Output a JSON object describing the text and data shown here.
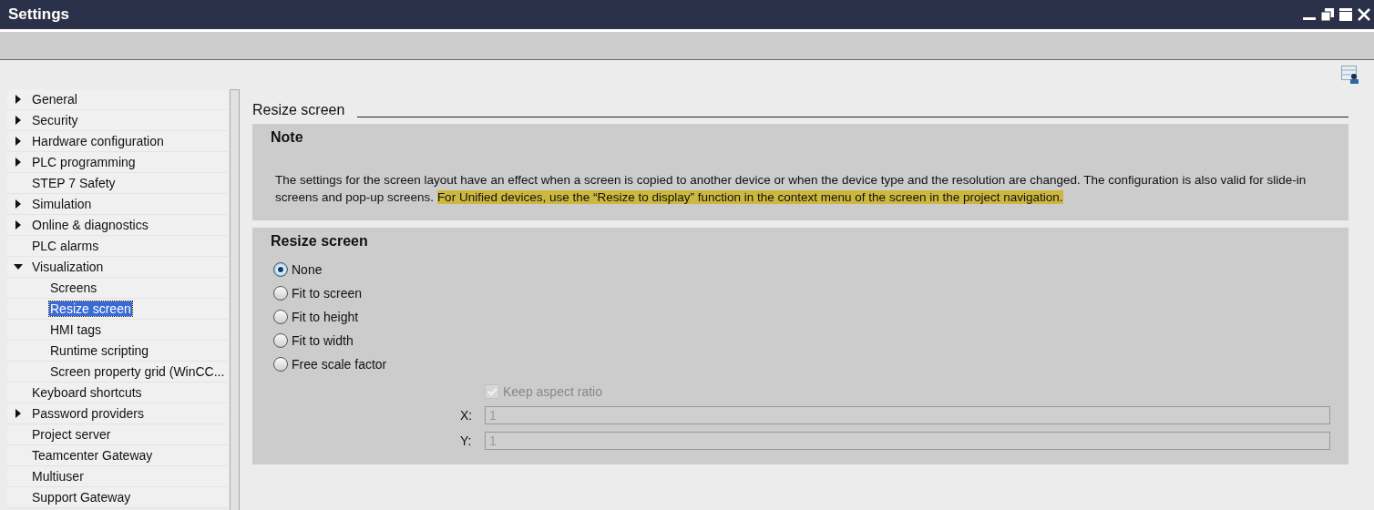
{
  "window": {
    "title": "Settings"
  },
  "sidebar": {
    "items": [
      {
        "label": "General",
        "expanded": false,
        "selected": false
      },
      {
        "label": "Security",
        "expanded": false,
        "selected": false
      },
      {
        "label": "Hardware configuration",
        "expanded": false,
        "selected": false
      },
      {
        "label": "PLC programming",
        "expanded": false,
        "selected": false
      },
      {
        "label": "STEP 7 Safety",
        "selected": false
      },
      {
        "label": "Simulation",
        "expanded": false,
        "selected": false
      },
      {
        "label": "Online & diagnostics",
        "expanded": false,
        "selected": false
      },
      {
        "label": "PLC alarms",
        "selected": false
      },
      {
        "label": "Visualization",
        "expanded": true,
        "selected": false,
        "children": [
          {
            "label": "Screens",
            "selected": false
          },
          {
            "label": "Resize screen",
            "selected": true
          },
          {
            "label": "HMI tags",
            "selected": false
          },
          {
            "label": "Runtime scripting",
            "selected": false
          },
          {
            "label": "Screen property grid (WinCC...",
            "selected": false
          }
        ]
      },
      {
        "label": "Keyboard shortcuts",
        "selected": false
      },
      {
        "label": "Password providers",
        "expanded": false,
        "selected": false
      },
      {
        "label": "Project server",
        "selected": false
      },
      {
        "label": "Teamcenter Gateway",
        "selected": false
      },
      {
        "label": "Multiuser",
        "selected": false
      },
      {
        "label": "Support Gateway",
        "selected": false
      }
    ]
  },
  "content": {
    "heading": "Resize screen",
    "note": {
      "title": "Note",
      "text": "The settings for the screen layout have an effect when a screen is copied to another device or when the device type and the resolution are changed. The configuration is also valid for slide-in screens and pop-up screens.",
      "highlighted_text": "For Unified devices, use the “Resize to display” function in the context menu of the screen in the project navigation."
    },
    "resize": {
      "title": "Resize screen",
      "options": [
        {
          "label": "None",
          "selected": true
        },
        {
          "label": "Fit to screen",
          "selected": false
        },
        {
          "label": "Fit to height",
          "selected": false
        },
        {
          "label": "Fit to width",
          "selected": false
        },
        {
          "label": "Free scale factor",
          "selected": false
        }
      ],
      "keep_aspect_ratio": {
        "label": "Keep aspect ratio",
        "checked": true,
        "disabled": true
      },
      "fields": [
        {
          "label": "X:",
          "value": "1",
          "disabled": true
        },
        {
          "label": "Y:",
          "value": "1",
          "disabled": true
        }
      ]
    }
  }
}
